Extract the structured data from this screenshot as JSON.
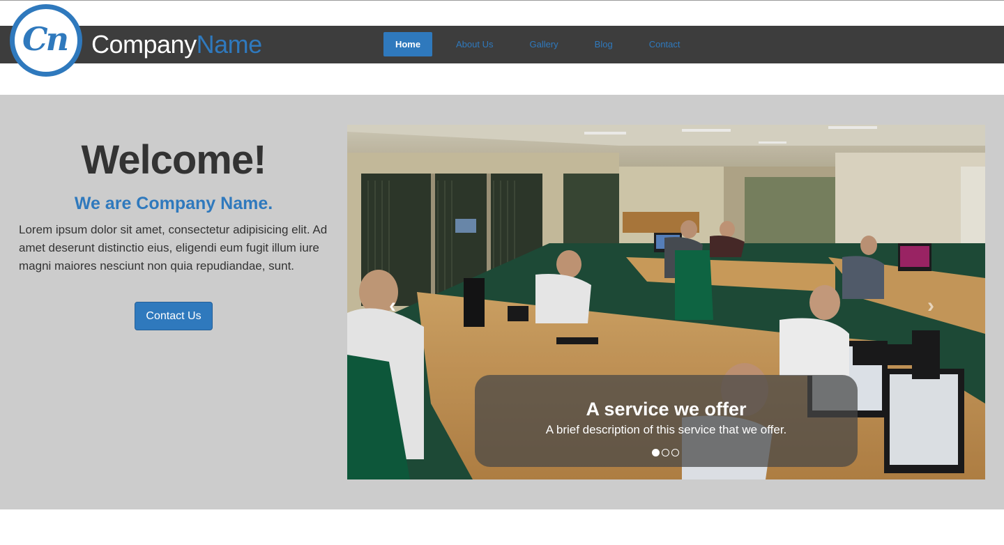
{
  "header": {
    "logo_text": "Cn",
    "brand_part1": "Company",
    "brand_part2": "Name"
  },
  "nav": {
    "items": [
      {
        "label": "Home",
        "active": true
      },
      {
        "label": "About Us",
        "active": false
      },
      {
        "label": "Gallery",
        "active": false
      },
      {
        "label": "Blog",
        "active": false
      },
      {
        "label": "Contact",
        "active": false
      }
    ]
  },
  "hero": {
    "title": "Welcome!",
    "subtitle": "We are Company Name.",
    "body": "Lorem ipsum dolor sit amet, consectetur adipisicing elit. Ad amet deserunt distinctio eius, eligendi eum fugit illum iure magni maiores nesciunt non quia repudiandae, sunt.",
    "button_label": "Contact Us"
  },
  "carousel": {
    "prev_icon": "‹",
    "next_icon": "›",
    "caption_title": "A service we offer",
    "caption_text": "A brief description of this service that we offer.",
    "slide_count": 3,
    "active_slide": 1
  },
  "colors": {
    "accent": "#2f79bd",
    "navbar": "#3d3d3d",
    "hero_bg": "#cccccc"
  }
}
